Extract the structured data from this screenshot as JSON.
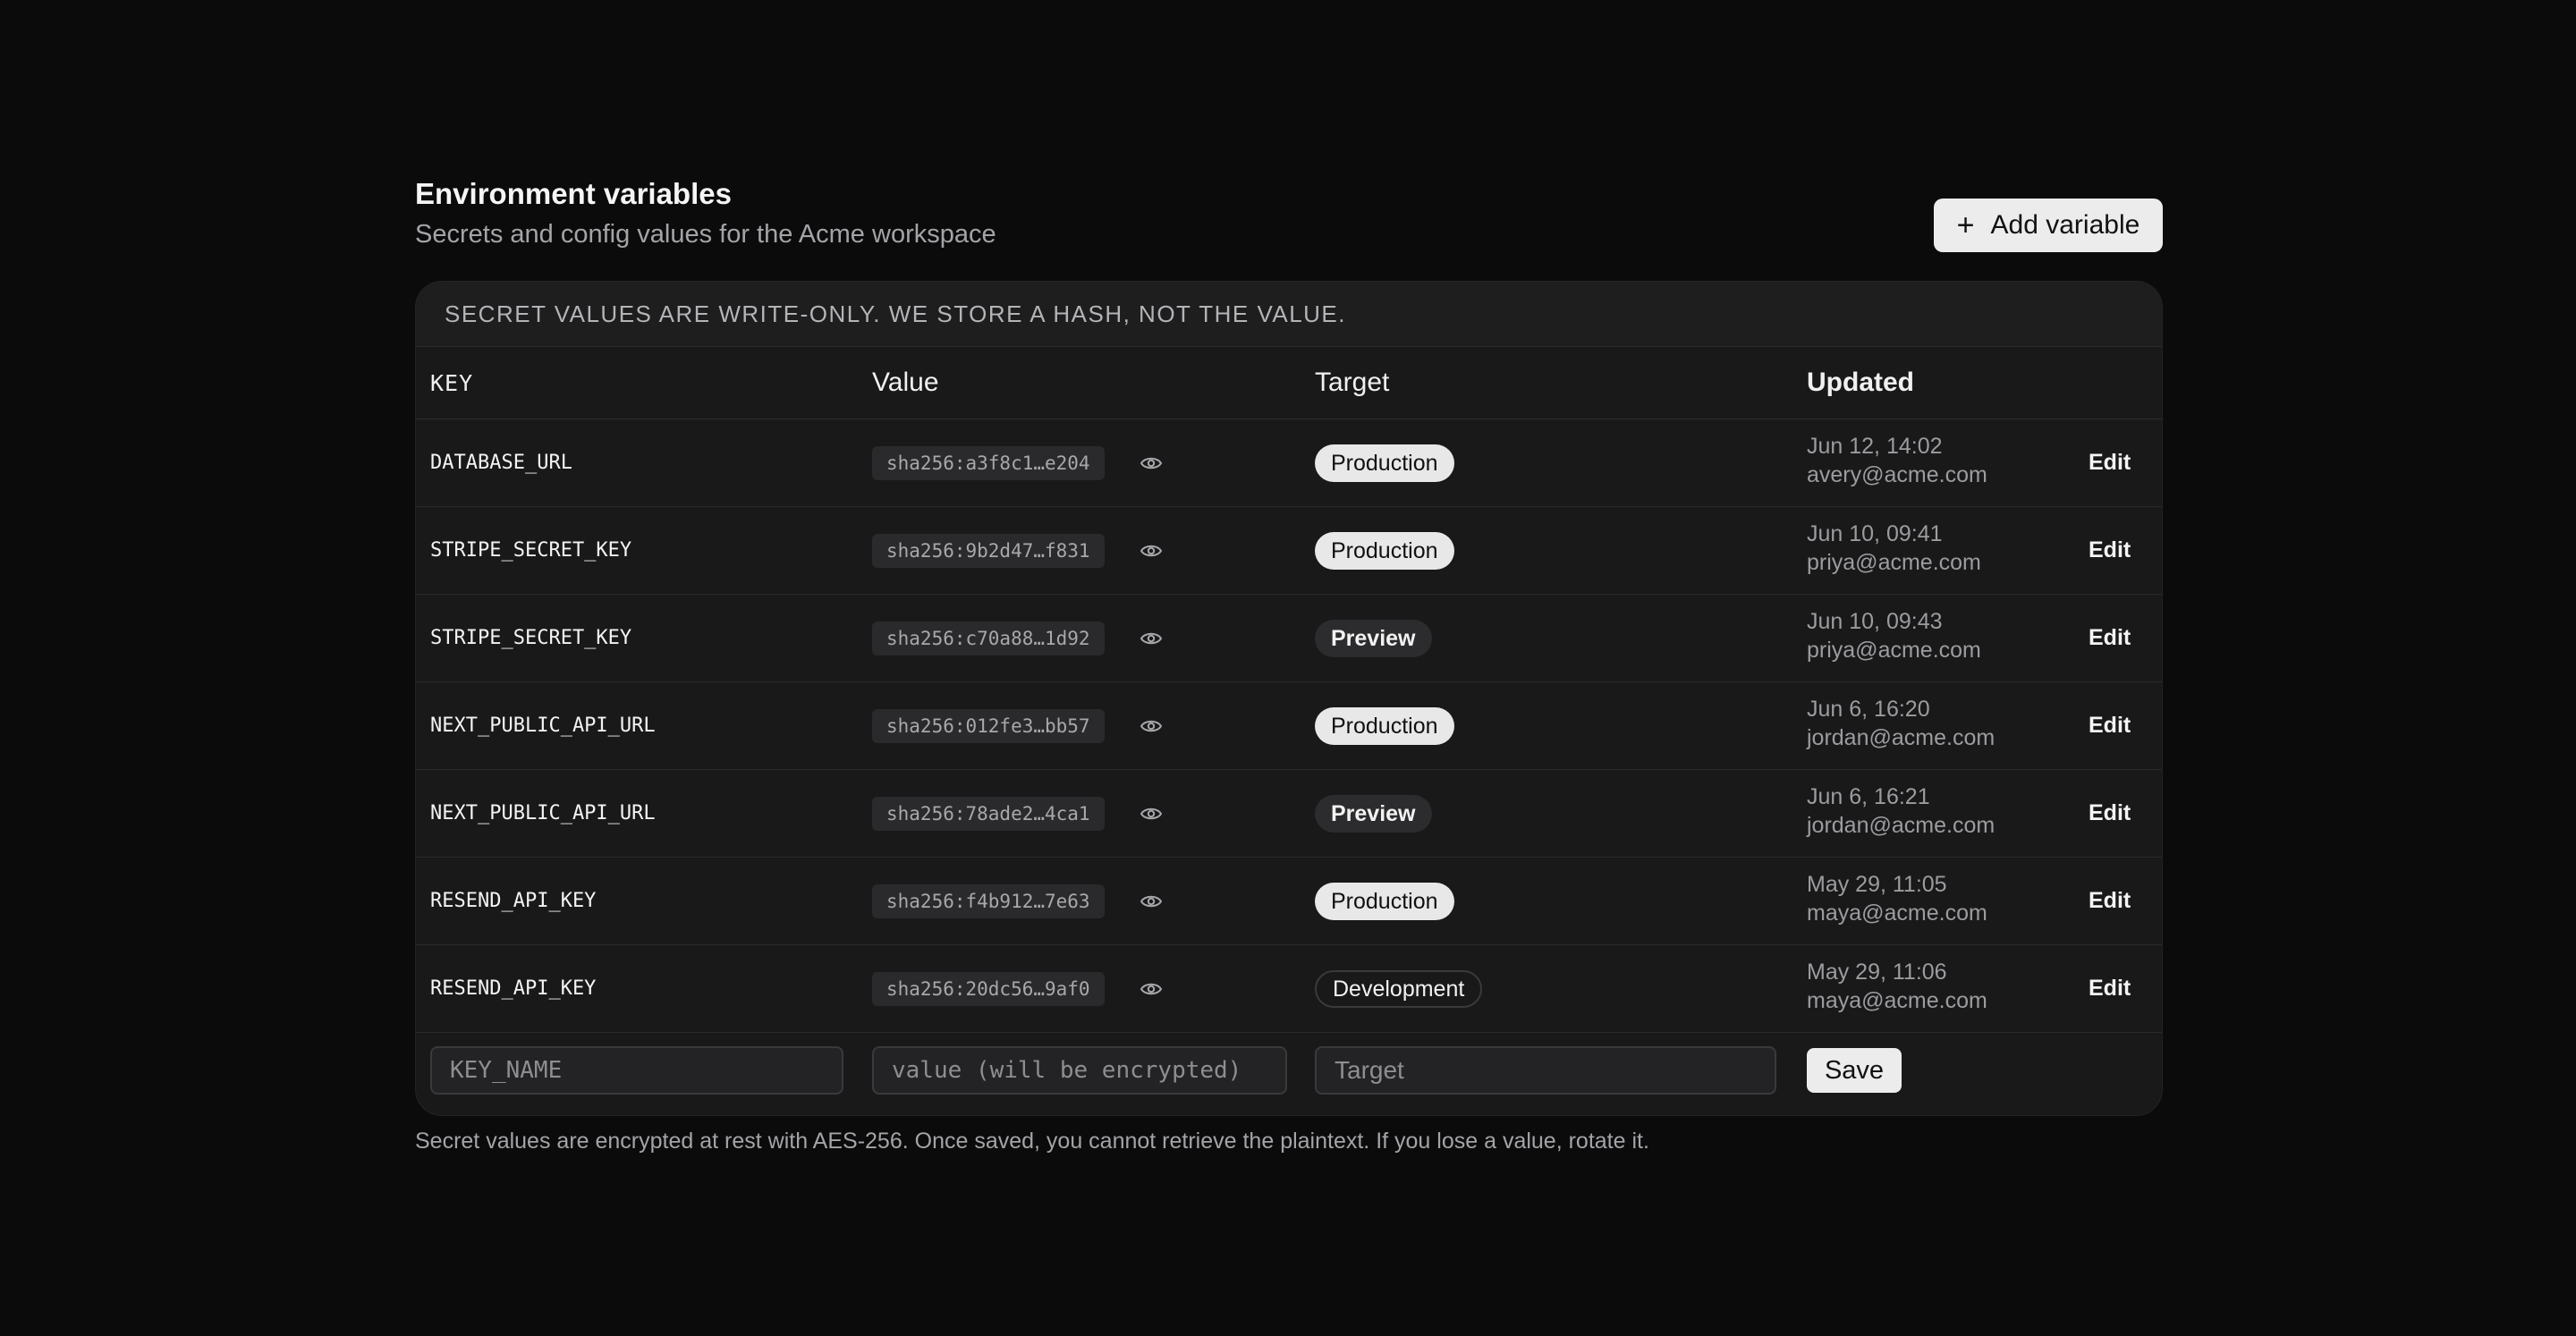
{
  "header": {
    "title": "Environment variables",
    "subtitle": "Secrets and config values for the Acme workspace",
    "add_button_label": "Add variable",
    "add_button_icon": "plus-icon"
  },
  "banner": "SECRET VALUES ARE WRITE-ONLY. WE STORE A HASH, NOT THE VALUE.",
  "table": {
    "columns": [
      "KEY",
      "Value",
      "Target",
      "Updated"
    ],
    "rows": [
      {
        "key": "DATABASE_URL",
        "hash": "sha256:a3f8c1…e204",
        "target": "Production",
        "updated": "Jun 12, 14:02",
        "by": "avery@acme.com",
        "action": "Edit"
      },
      {
        "key": "STRIPE_SECRET_KEY",
        "hash": "sha256:9b2d47…f831",
        "target": "Production",
        "updated": "Jun 10, 09:41",
        "by": "priya@acme.com",
        "action": "Edit"
      },
      {
        "key": "STRIPE_SECRET_KEY",
        "hash": "sha256:c70a88…1d92",
        "target": "Preview",
        "updated": "Jun 10, 09:43",
        "by": "priya@acme.com",
        "action": "Edit"
      },
      {
        "key": "NEXT_PUBLIC_API_URL",
        "hash": "sha256:012fe3…bb57",
        "target": "Production",
        "updated": "Jun 6, 16:20",
        "by": "jordan@acme.com",
        "action": "Edit"
      },
      {
        "key": "NEXT_PUBLIC_API_URL",
        "hash": "sha256:78ade2…4ca1",
        "target": "Preview",
        "updated": "Jun 6, 16:21",
        "by": "jordan@acme.com",
        "action": "Edit"
      },
      {
        "key": "RESEND_API_KEY",
        "hash": "sha256:f4b912…7e63",
        "target": "Production",
        "updated": "May 29, 11:05",
        "by": "maya@acme.com",
        "action": "Edit"
      },
      {
        "key": "RESEND_API_KEY",
        "hash": "sha256:20dc56…9af0",
        "target": "Development",
        "updated": "May 29, 11:06",
        "by": "maya@acme.com",
        "action": "Edit"
      }
    ]
  },
  "form": {
    "key_placeholder": "KEY_NAME",
    "value_placeholder": "value (will be encrypted)",
    "target_placeholder": "Target",
    "save_label": "Save"
  },
  "footnote": "Secret values are encrypted at rest with AES-256. Once saved, you cannot retrieve the plaintext. If you lose a value, rotate it.",
  "colors": {
    "background": "#0b0b0c",
    "card": "#19191a",
    "production_badge": "#e8e8e8",
    "preview_badge": "#2c2c2e"
  }
}
